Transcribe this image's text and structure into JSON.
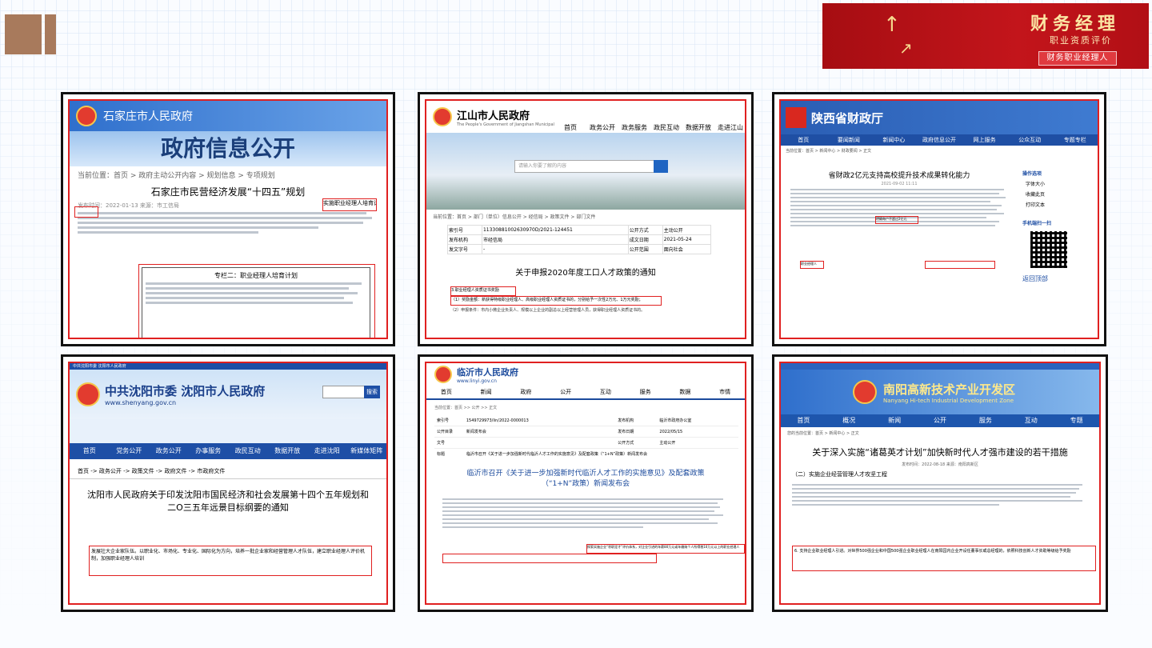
{
  "banner": {
    "title": "财务经理",
    "subtitle": "职业资质评价",
    "tag": "财务职业经理人"
  },
  "cards": [
    {
      "site": "石家庄市人民政府",
      "headline": "政府信息公开",
      "breadcrumb": "当前位置：首页 > 政府主动公开内容 > 规划信息 > 专项规划",
      "doc_title": "石家庄市民营经济发展“十四五”规划",
      "meta": "发布时间：2022-01-13    来源：市工信局",
      "highlight_text": "实施职业经理人培育计划",
      "box_title": "专栏二：职业经理人培育计划"
    },
    {
      "site": "江山市人民政府",
      "site_en": "The People's Government of Jiangshan Municipal",
      "nav": [
        "首页",
        "政务公开",
        "政务服务",
        "政民互动",
        "数据开放",
        "走进江山"
      ],
      "search_placeholder": "请输入你要了解的内容",
      "breadcrumb": "当前位置：首页 > 部门（单位）信息公开 > 经信局 > 政策文件 > 部门文件",
      "table": [
        [
          "索引号",
          "11330881002630970D/2021-124451",
          "公开方式",
          "主动公开"
        ],
        [
          "发布机构",
          "市经信局",
          "成文日期",
          "2021-05-24"
        ],
        [
          "发文字号",
          "-",
          "公开范围",
          "面向社会"
        ]
      ],
      "doc_title": "关于申报2020年度工口人才政策的通知",
      "highlight1": "3.职业经理人资质证书奖励",
      "highlight2": "（1）奖励金额：新获得特级职业经理人、高级职业经理人资质证书的，分别给予一次性2万元、1万元奖励；",
      "footer_text": "（2）申报条件：市内小微企业负责人、规模以上企业的副总以上经营管理人员，获得职业经理人资质证书的。"
    },
    {
      "site": "陕西省财政厅",
      "nav": [
        "首页",
        "要闻新闻",
        "新闻中心",
        "政府信息公开",
        "网上服务",
        "公众互动",
        "专题专栏"
      ],
      "breadcrumb": "当前位置：首页 > 新闻中心 > 财政要闻 > 正文",
      "doc_title": "省财政2亿元支持高校提升技术成果转化能力",
      "meta": "2021-09-02 11:11",
      "highlight1": "明确每户不超过2亿元",
      "highlight2": "职业经理人",
      "side_label1": "操作选项",
      "side_items": [
        "字体大小",
        "收藏此页",
        "打印文本"
      ],
      "side_label2": "手机端扫一扫",
      "back_top": "返回顶部"
    },
    {
      "topbar": "中共沈阳市委 沈阳市人民政府",
      "site": "中共沈阳市委  沈阳市人民政府",
      "url": "www.shenyang.gov.cn",
      "search_button": "搜索",
      "nav": [
        "首页",
        "党务公开",
        "政务公开",
        "办事服务",
        "政民互动",
        "数据开放",
        "走进沈阳",
        "新媒体矩阵"
      ],
      "breadcrumb": "首页 -> 政务公开 -> 政策文件 -> 政府文件 -> 市政府文件",
      "doc_title": "沈阳市人民政府关于印发沈阳市国民经济和社会发展第十四个五年规划和二O三五年远景目标纲要的通知",
      "highlight_text": "发展壮大企业家队伍。以职业化、市场化、专业化、国际化为方向，培养一批企业家和经营管理人才队伍，建立职业经理人评价机制，加强职业经理人培训"
    },
    {
      "site": "临沂市人民政府",
      "url": "www.linyi.gov.cn",
      "nav": [
        "首页",
        "新闻",
        "政府",
        "公开",
        "互动",
        "服务",
        "数据",
        "市情"
      ],
      "breadcrumb": "当前位置：首页 >> 公开 >> 正文",
      "table": [
        [
          "索引号",
          "1549729973/lin/2022-0000013",
          "发布机构",
          "临沂市政府办公室"
        ],
        [
          "公开目录",
          "新闻发布会",
          "发布日期",
          "2022/05/15"
        ],
        [
          "文号",
          "",
          "公开方式",
          "主动公开"
        ],
        [
          "标题",
          "临沂市召开《关于进一步加强新时代临沂人才工作的实施意见》及配套政策（“1+N”政策）新闻发布会",
          "",
          ""
        ]
      ],
      "doc_title": "临沂市召开《关于进一步加强新时代临沂人才工作的实施意见》及配套政策",
      "doc_subtitle": "（“1+N”政策）新闻发布会",
      "highlight_text": "探索实施企业“积职定才”评价体系，对企业引进的年薪80万元或年缴纳个人所得税10万元以上的职业经理人"
    },
    {
      "site": "南阳高新技术产业开发区",
      "site_en": "Nanyang Hi-tech Industrial Development Zone",
      "nav": [
        "首页",
        "概况",
        "新闻",
        "公开",
        "服务",
        "互动",
        "专题"
      ],
      "breadcrumb": "您的当前位置：首页 > 新闻中心 > 正文",
      "doc_title": "关于深入实施“诸葛英才计划”加快新时代人才强市建设的若干措施",
      "meta": "发布时间：2022-08-18   来源：南阳高新区",
      "section": "（二）实施企业经营管理人才攻坚工程",
      "highlight_text": "6. 支持企业职业经理人引进。对世界500强企业和中国500强企业职业经理人在南阳园内企业开设任董事长或总经理的，依照科技创新人才资助等级给予奖励"
    }
  ],
  "colors": {
    "frame": "#111111",
    "highlight": "#e02020",
    "banner_red": "#b51116",
    "accent_brown": "#a87a5c"
  }
}
